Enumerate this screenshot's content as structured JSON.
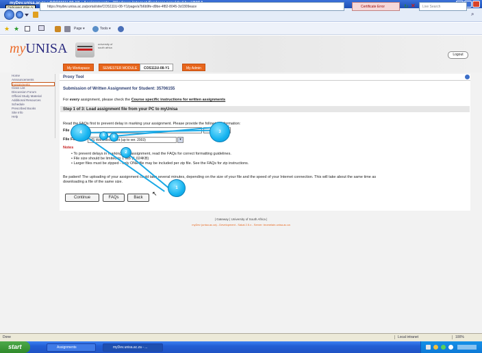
{
  "window": {
    "title": "myDev.unisa.ac.za : COS111U-08-Y1 : Assignments - Windows Internet Explorer provided by UNISA",
    "tooltip": "Participant Wise Ar"
  },
  "browser": {
    "address": "https://mydev.unisa.ac.za/portal/site/COS111U-08-Y1/page/a7b6b9fe-d9be-4f82-8045-3c0309eace",
    "cert_error": "Certificate Error",
    "search_placeholder": "Live Search",
    "page_menu": "Page",
    "tools_menu": "Tools"
  },
  "header": {
    "logo_prefix": "my",
    "logo_main": "UNISA",
    "crest_text": "university of south africa",
    "logout": "Logout"
  },
  "tabs": [
    {
      "label": "My Workspace"
    },
    {
      "label": "SEMESTER MODULE"
    },
    {
      "label": "COS111U-08-Y1"
    },
    {
      "label": "My Admin"
    }
  ],
  "sidebar": [
    "Home",
    "Announcements",
    "Assignments",
    "Class List",
    "Discussion Forum",
    "Official Study Material",
    "Additional Resources",
    "Schedule",
    "Prescribed Books",
    "Site Info",
    "Help"
  ],
  "main": {
    "tool_title": "Proxy Tool",
    "heading": "Submission of Written Assignment for Student: 35706155",
    "instruction_prefix": "For ",
    "instruction_every": "every",
    "instruction_mid": " assignment, please check the ",
    "instruction_link": "Course specific instructions for written assignments",
    "step": "Step 1 of 3: Load assignment file from your PC to myUnisa",
    "faq_text": "Read the FAQs first to prevent delay in marking your assignment. Please provide the following information:",
    "file_label": "File",
    "browse": "Browse...",
    "format_label": "File Format",
    "format_value": "MS Word document (up to ver. 2003)",
    "notes_label": "Notes",
    "notes": [
      "To prevent delays in marking your assignment, read the FAQs for correct formatting guidelines.",
      "File size should be limited to 1 MB (1,024KB)",
      "Larger files must be zipped - only ONE file may be included per zip file. See the FAQs for zip instructions."
    ],
    "patience": "Be patient! The uploading of your assignment could take several minutes, depending on the size of your file and the speed of your Internet connection. This will take about the same time as",
    "patience2": "downloading a file of the same size.",
    "buttons": {
      "continue": "Continue",
      "faqs": "FAQs",
      "back": "Back"
    }
  },
  "footer": {
    "links": "|   Gateway   |   University of South Africa   |",
    "powered": "myDev (unisa.ac.za) - Development - Sakai 2.5.x - Server: bromelain.unisa.ac.za"
  },
  "annotations": [
    {
      "number": "1"
    },
    {
      "number": "2"
    },
    {
      "number": "3"
    },
    {
      "number": "4"
    },
    {
      "number": "5"
    },
    {
      "number": "6"
    }
  ],
  "statusbar": {
    "left": "Done",
    "zone": "Local intranet",
    "zoom": "100%"
  },
  "taskbar": {
    "start": "start",
    "items": [
      "Assignments",
      "myDev.unisa.ac.za - ..."
    ]
  }
}
